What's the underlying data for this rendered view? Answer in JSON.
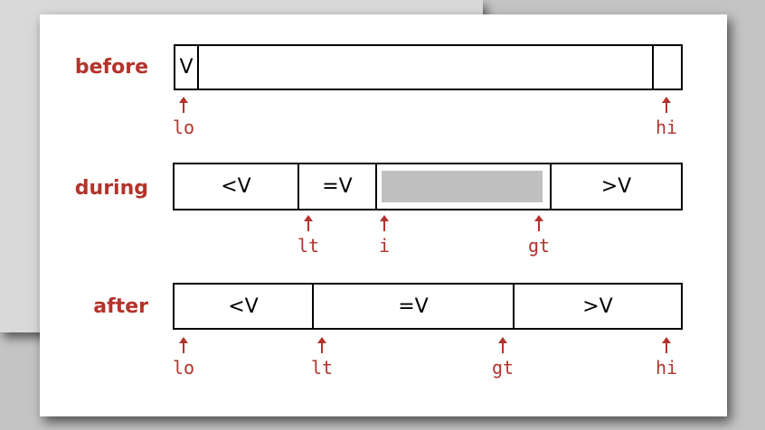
{
  "rows": {
    "before": {
      "label": "before",
      "cells": [
        "V",
        ""
      ],
      "pointers": [
        "lo",
        "hi"
      ]
    },
    "during": {
      "label": "during",
      "cells": [
        "<V",
        "=V",
        "",
        ">V"
      ],
      "pointers": [
        "lt",
        "i",
        "gt"
      ]
    },
    "after": {
      "label": "after",
      "cells": [
        "<V",
        "=V",
        ">V"
      ],
      "pointers": [
        "lo",
        "lt",
        "gt",
        "hi"
      ]
    }
  }
}
